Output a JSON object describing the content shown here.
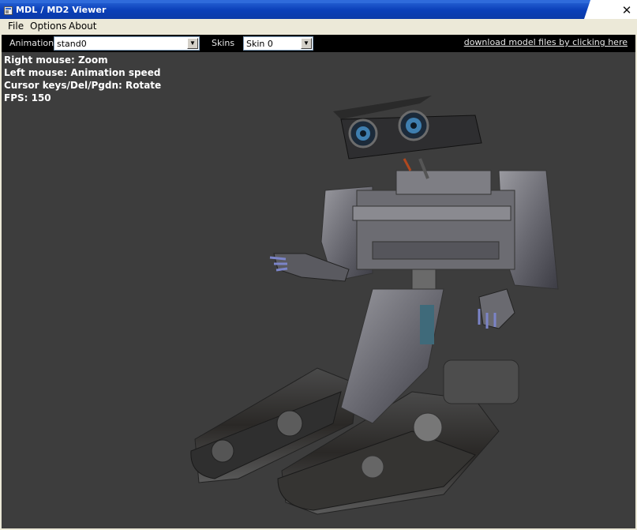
{
  "window": {
    "title": "MDL / MD2 Viewer",
    "close_glyph": "✕"
  },
  "menu": {
    "items": [
      "File",
      "Options",
      "About"
    ]
  },
  "toolbar": {
    "animation_label": "Animation",
    "animation_value": "stand0",
    "skins_label": "Skins",
    "skins_value": "Skin 0",
    "download_link": "download model files by clicking here"
  },
  "hud": {
    "line1": "Right mouse: Zoom",
    "line2": "Left mouse: Animation speed",
    "line3": "Cursor keys/Del/Pgdn: Rotate",
    "line4": "FPS: 150"
  },
  "viewport": {
    "background": "#3d3d3d",
    "model": "robot-model"
  },
  "colors": {
    "titlebar": "#0a3fb8",
    "toolbar": "#000000",
    "menubar": "#ece9d8"
  }
}
